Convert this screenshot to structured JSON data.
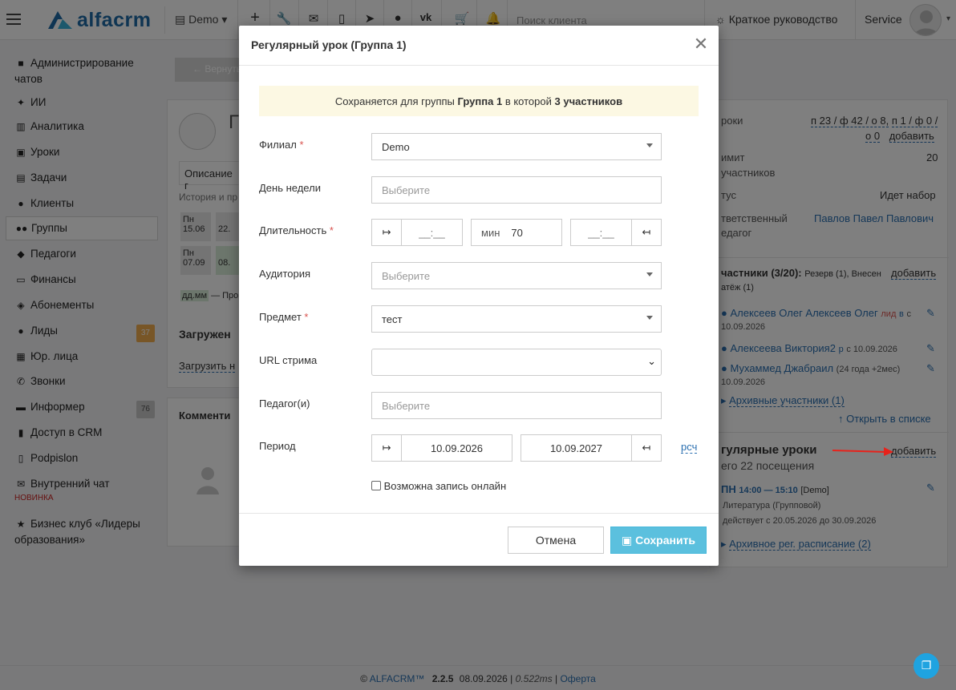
{
  "topbar": {
    "logo_text": "alfacrm",
    "branch": "Demo",
    "search_placeholder": "Поиск клиента",
    "guide": "Краткое руководство",
    "user": "Service"
  },
  "sidebar": {
    "items": [
      {
        "label": "Администрирование чатов",
        "icon": "chat-admin-icon"
      },
      {
        "label": "ИИ",
        "icon": "sparkle-icon"
      },
      {
        "label": "Аналитика",
        "icon": "map-icon"
      },
      {
        "label": "Уроки",
        "icon": "calendar-icon"
      },
      {
        "label": "Задачи",
        "icon": "tasks-icon"
      },
      {
        "label": "Клиенты",
        "icon": "user-icon"
      },
      {
        "label": "Группы",
        "icon": "group-icon"
      },
      {
        "label": "Педагоги",
        "icon": "graduation-cap-icon"
      },
      {
        "label": "Финансы",
        "icon": "money-icon"
      },
      {
        "label": "Абонементы",
        "icon": "tag-icon"
      },
      {
        "label": "Лиды",
        "icon": "leads-icon",
        "badge": "37"
      },
      {
        "label": "Юр. лица",
        "icon": "building-icon"
      },
      {
        "label": "Звонки",
        "icon": "phone-icon"
      },
      {
        "label": "Информер",
        "icon": "informer-icon",
        "badge": "76"
      },
      {
        "label": "Доступ в CRM",
        "icon": "lock-icon"
      },
      {
        "label": "Podpislon",
        "icon": "file-icon"
      },
      {
        "label": "Внутренний чат",
        "icon": "envelope-icon",
        "tag": "НОВИНКА"
      },
      {
        "label": "Бизнес клуб «Лидеры образования»",
        "icon": "star-icon"
      }
    ]
  },
  "background": {
    "back_btn": "← Вернуть",
    "group_initial": "Г",
    "description": "Описание г",
    "history": "История и пр",
    "day1": "Пн",
    "date1": "15.06",
    "day2": "Пн",
    "date2": "07.09",
    "col2a": "22.",
    "col2b": "08.",
    "date_hint": "дд.мм",
    "date_hint_suffix": "— Про",
    "loaded": "Загружен",
    "upload": "Загрузить н",
    "comments": "Комменти",
    "right": {
      "lessons_label": "роки",
      "lessons_value_1": "п 23 / ф 42 / о 8,",
      "lessons_value_2": "п 1 / ф 0 /",
      "lessons_value_3": "о 0",
      "lessons_add": "добавить",
      "limit_label_1": "имит",
      "limit_label_2": "участников",
      "limit_value": "20",
      "status_label": "тус",
      "status_value": "Идет набор",
      "teacher_label_1": "тветственный",
      "teacher_label_2": "едагог",
      "teacher_value": "Павлов Павел Павлович",
      "participants_title": "частники (3/20):",
      "participants_meta": "Резерв (1), Внесен",
      "participants_meta2": "атёж (1)",
      "participants_add": "добавить",
      "p1": "Алексеев Олег Алексеев Олег",
      "p1_tag": "лид",
      "p1_tag2": "в",
      "p1_tag3": "с",
      "p1_date": "10.09.2026",
      "p2": "Алексеева Виктория2",
      "p2_tag": "р",
      "p2_date": "с 10.09.2026",
      "p3": "Мухаммед Джабраил",
      "p3_meta": "(24 года +2мес)",
      "p3_date": "10.09.2026",
      "archived": "Архивные участники (1)",
      "open_list": "↑ Открыть в списке",
      "regular_title": "гулярные уроки",
      "regular_add": "добавить",
      "regular_total": "его 22 посещения",
      "slot_day": "ПН",
      "slot_time": "14:00 — 15:10",
      "slot_branch": "[Demo]",
      "slot_subject": "Литература (Групповой)",
      "slot_period": "действует с 20.05.2026 до 30.09.2026",
      "archived_sched": "Архивное рег. расписание (2)"
    }
  },
  "modal": {
    "title": "Регулярный урок (Группа 1)",
    "alert_pre": "Сохраняется для группы",
    "alert_group": "Группа 1",
    "alert_mid": "в которой",
    "alert_count": "3 участников",
    "branch_label": "Филиал",
    "branch_value": "Demo",
    "weekday_label": "День недели",
    "weekday_placeholder": "Выберите",
    "duration_label": "Длительность",
    "time_start_placeholder": "__:__",
    "min_label": "мин",
    "duration_value": "70",
    "time_end_placeholder": "__:__",
    "room_label": "Аудитория",
    "room_placeholder": "Выберите",
    "subject_label": "Предмет",
    "subject_value": "тест",
    "stream_label": "URL стрима",
    "stream_value": "",
    "teacher_label": "Педагог(и)",
    "teacher_placeholder": "Выберите",
    "period_label": "Период",
    "period_start": "10.09.2026",
    "period_end": "10.09.2027",
    "period_calc": "рсч",
    "online_label": "Возможна запись онлайн",
    "online_checked": false,
    "cancel": "Отмена",
    "save": "Сохранить"
  },
  "footer": {
    "brand": "ALFACRM™",
    "version": "2.2.5",
    "date": "08.09.2026",
    "time": "0.522ms",
    "offer": "Оферта"
  }
}
